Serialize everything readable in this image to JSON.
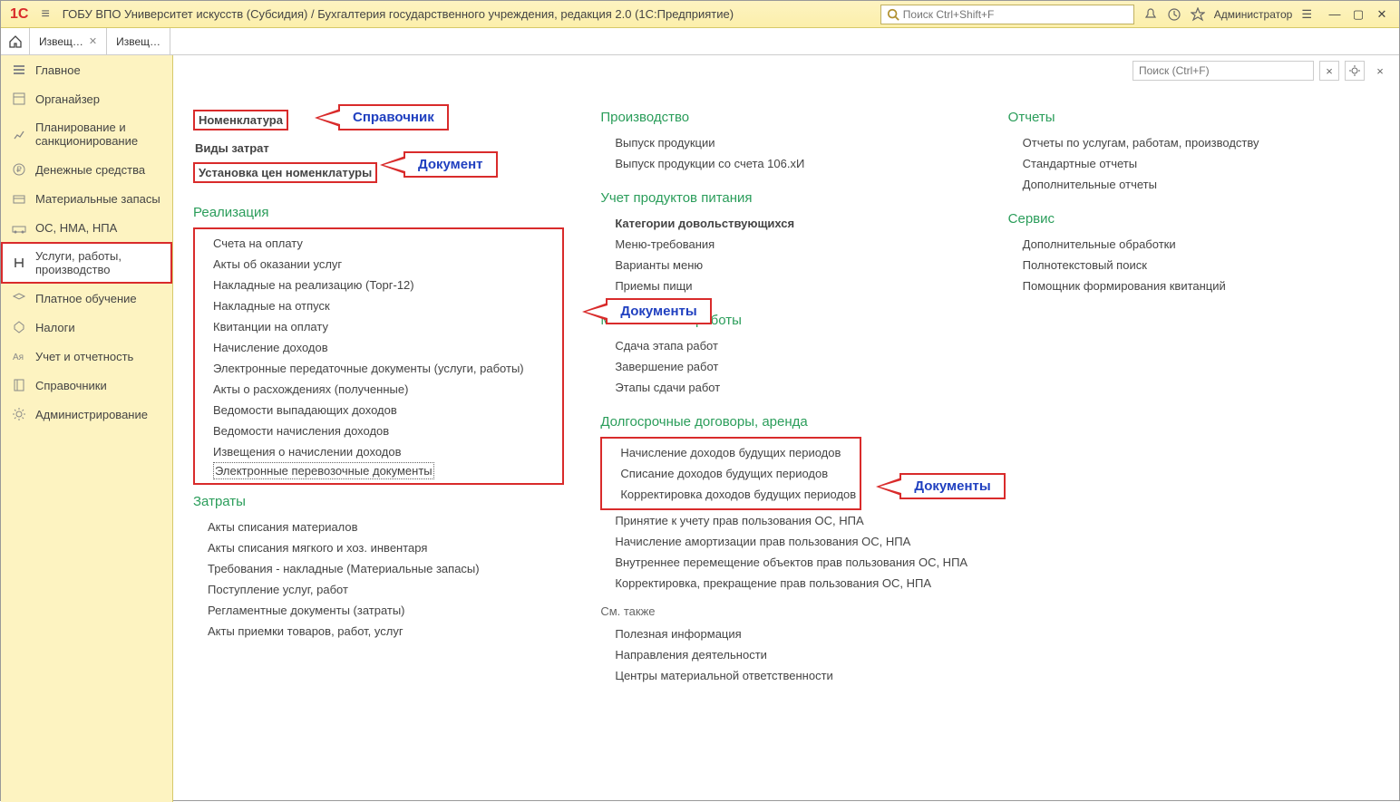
{
  "titlebar": {
    "title": "ГОБУ ВПО Университет искусств (Субсидия) / Бухгалтерия государственного учреждения, редакция 2.0  (1С:Предприятие)",
    "search_placeholder": "Поиск Ctrl+Shift+F",
    "user": "Администратор"
  },
  "tabs": [
    "Извещ…",
    "Извещ…"
  ],
  "sidebar": [
    {
      "label": "Главное"
    },
    {
      "label": "Органайзер"
    },
    {
      "label": "Планирование и санкционирование"
    },
    {
      "label": "Денежные средства"
    },
    {
      "label": "Материальные запасы"
    },
    {
      "label": "ОС, НМА, НПА"
    },
    {
      "label": "Услуги, работы, производство",
      "active": true
    },
    {
      "label": "Платное обучение"
    },
    {
      "label": "Налоги"
    },
    {
      "label": "Учет и отчетность"
    },
    {
      "label": "Справочники"
    },
    {
      "label": "Администрирование"
    }
  ],
  "content": {
    "search_placeholder": "Поиск (Ctrl+F)",
    "col1": {
      "top": [
        "Номенклатура",
        "Виды затрат",
        "Установка цен номенклатуры"
      ],
      "h1": "Реализация",
      "realiz": [
        "Счета на оплату",
        "Акты об оказании услуг",
        "Накладные на реализацию (Торг-12)",
        "Накладные на отпуск",
        "Квитанции на оплату",
        "Начисление доходов",
        "Электронные передаточные документы (услуги, работы)",
        "Акты о расхождениях (полученные)",
        "Ведомости выпадающих доходов",
        "Ведомости начисления доходов",
        "Извещения о начислении доходов",
        "Электронные перевозочные документы"
      ],
      "h2": "Затраты",
      "zatr": [
        "Акты списания материалов",
        "Акты списания мягкого и хоз. инвентаря",
        "Требования - накладные (Материальные запасы)",
        "Поступление услуг, работ",
        "Регламентные документы (затраты)",
        "Акты приемки товаров, работ, услуг"
      ]
    },
    "col2": {
      "h1": "Производство",
      "prod": [
        "Выпуск продукции",
        "Выпуск продукции со счета 106.хИ"
      ],
      "h2": "Учет продуктов питания",
      "food": [
        "Категории довольствующихся",
        "Меню-требования",
        "Варианты меню",
        "Приемы пищи"
      ],
      "h3": "Многоэтапные работы",
      "multi": [
        "Сдача этапа работ",
        "Завершение работ",
        "Этапы сдачи работ"
      ],
      "h4": "Долгосрочные договоры, аренда",
      "dlg_box": [
        "Начисление доходов будущих периодов",
        "Списание доходов будущих периодов",
        "Корректировка доходов будущих периодов"
      ],
      "dlg_rest": [
        "Принятие к учету прав пользования ОС, НПА",
        "Начисление амортизации прав пользования ОС, НПА",
        "Внутреннее перемещение объектов прав пользования ОС, НПА",
        "Корректировка, прекращение прав пользования ОС, НПА"
      ],
      "see": "См. также",
      "seealso": [
        "Полезная информация",
        "Направления деятельности",
        "Центры материальной ответственности"
      ]
    },
    "col3": {
      "h1": "Отчеты",
      "rep": [
        "Отчеты по услугам, работам, производству",
        "Стандартные отчеты",
        "Дополнительные отчеты"
      ],
      "h2": "Сервис",
      "srv": [
        "Дополнительные обработки",
        "Полнотекстовый поиск",
        "Помощник формирования квитанций"
      ]
    },
    "callouts": {
      "sprav": "Справочник",
      "doc1": "Документ",
      "docs1": "Документы",
      "docs2": "Документы"
    }
  }
}
